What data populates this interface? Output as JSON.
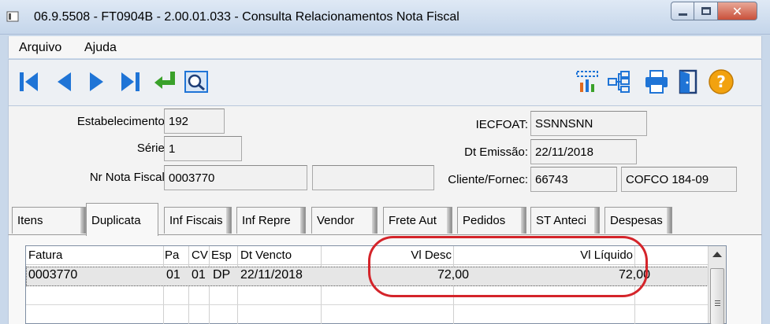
{
  "window": {
    "title": "06.9.5508 - FT0904B - 2.00.01.033 - Consulta Relacionamentos Nota Fiscal",
    "min_glyph": "minimize-icon",
    "max_glyph": "maximize-icon",
    "close_glyph": "✕"
  },
  "menu": {
    "items": [
      {
        "label": "Arquivo"
      },
      {
        "label": "Ajuda"
      }
    ]
  },
  "toolbar": {
    "icons": [
      "first-record-icon",
      "previous-record-icon",
      "next-record-icon",
      "last-record-icon",
      "go-to-icon",
      "zoom-search-icon",
      "report-chart-icon",
      "tree-structure-icon",
      "print-icon",
      "exit-door-icon",
      "help-icon"
    ]
  },
  "form": {
    "estabelecimento": {
      "label": "Estabelecimento:",
      "value": "192"
    },
    "serie": {
      "label": "Série:",
      "value": "1"
    },
    "nr_nota_fiscal": {
      "label": "Nr Nota Fiscal:",
      "value": "0003770",
      "extra_value": ""
    },
    "iecfoat": {
      "label": "IECFOAT:",
      "value": "SSNNSNN"
    },
    "dt_emissao": {
      "label": "Dt Emissão:",
      "value": "22/11/2018"
    },
    "cliente_fornec": {
      "label": "Cliente/Fornec:",
      "value": "66743",
      "name": "COFCO 184-09"
    }
  },
  "tabs": [
    {
      "label": "Itens"
    },
    {
      "label": "Duplicata"
    },
    {
      "label": "Inf Fiscais"
    },
    {
      "label": "Inf Repre"
    },
    {
      "label": "Vendor"
    },
    {
      "label": "Frete Aut"
    },
    {
      "label": "Pedidos"
    },
    {
      "label": "ST Anteci"
    },
    {
      "label": "Despesas"
    }
  ],
  "active_tab": "Duplicata",
  "grid": {
    "columns": [
      "Fatura",
      "Pa",
      "CV",
      "Esp",
      "Dt Vencto",
      "Vl Desc",
      "Vl Líquido"
    ],
    "rows": [
      {
        "fatura": "0003770",
        "pa": "01",
        "cv": "01",
        "esp": "DP",
        "dt_vencto": "22/11/2018",
        "vl_desc": "72,00",
        "vl_liquido": "72,00"
      }
    ]
  },
  "colors": {
    "highlight": "#d4242a",
    "toolbar_icon": "#1f74d6",
    "help_icon": "#f2a20f"
  }
}
